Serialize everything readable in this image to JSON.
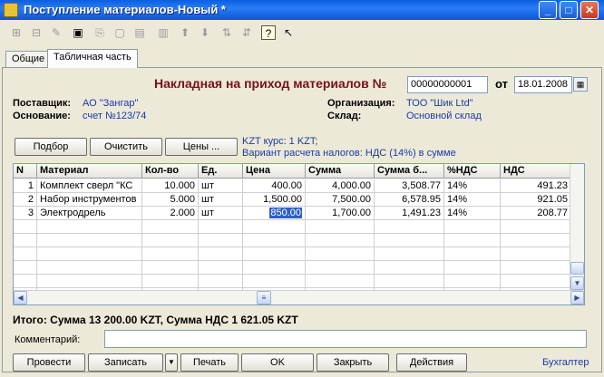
{
  "window": {
    "title": "Поступление материалов-Новый *",
    "min_glyph": "_",
    "max_glyph": "□",
    "close_glyph": "✕"
  },
  "toolbar": {
    "icons": [
      "add-row-icon",
      "add-copy-icon",
      "edit-row-icon",
      "delete-row-icon",
      "end-edit-icon",
      "copy-icon",
      "mark-icon",
      "unmark-icon",
      "move-up-icon",
      "move-down-icon",
      "sort-asc-icon",
      "sort-desc-icon",
      "help-icon",
      "whats-this-icon"
    ],
    "glyphs": [
      "⊞",
      "⊟",
      "✎",
      "▣",
      "⎘",
      "▢",
      "▤",
      "▥",
      "⬆",
      "⬇",
      "⇅",
      "⇵",
      "?",
      "↖"
    ]
  },
  "tabs": [
    "Общие",
    "Табличная часть"
  ],
  "doc": {
    "title": "Накладная на приход материалов №",
    "number": "00000000001",
    "date_label": "от",
    "date": "18.01.2008",
    "cal_glyph": "▦"
  },
  "supplier": {
    "label": "Поставщик:",
    "value": "АО \"Зангар\""
  },
  "basis": {
    "label": "Основание:",
    "value": "счет №123/74"
  },
  "org": {
    "label": "Организация:",
    "value": "ТОО \"Шик Ltd\""
  },
  "warehouse": {
    "label": "Склад:",
    "value": "Основной склад"
  },
  "buttons": {
    "select": "Подбор",
    "clear": "Очистить",
    "prices": "Цены ..."
  },
  "info": {
    "rate": "KZT курс: 1 KZT;",
    "tax": "Вариант расчета налогов: НДС (14%) в сумме"
  },
  "table": {
    "columns": [
      "N",
      "Материал",
      "Кол-во",
      "Ед.",
      "Цена",
      "Сумма",
      "Сумма б...",
      "%НДС",
      "НДС"
    ],
    "rows": [
      [
        "1",
        "Комплект сверл \"КС",
        "10.000",
        "шт",
        "400.00",
        "4,000.00",
        "3,508.77",
        "14%",
        "491.23"
      ],
      [
        "2",
        "Набор инструментов",
        "5.000",
        "шт",
        "1,500.00",
        "7,500.00",
        "6,578.95",
        "14%",
        "921.05"
      ],
      [
        "3",
        "Электродрель",
        "2.000",
        "шт",
        "850.00",
        "1,700.00",
        "1,491.23",
        "14%",
        "208.77"
      ]
    ]
  },
  "total": "Итого: Сумма 13 200.00 KZT, Сумма НДС 1 621.05 KZT",
  "comment": {
    "label": "Комментарий:",
    "value": ""
  },
  "footer": {
    "post": "Провести",
    "save": "Записать",
    "print": "Печать",
    "ok": "OK",
    "close": "Закрыть",
    "actions": "Действия",
    "dropdown_glyph": "▼",
    "role": "Бухгалтер"
  },
  "colors": {
    "title_bar": "#0b55d8",
    "doc_title": "#7a0f1e",
    "selection": "#2f5fc4",
    "link": "#1a3aa8"
  }
}
